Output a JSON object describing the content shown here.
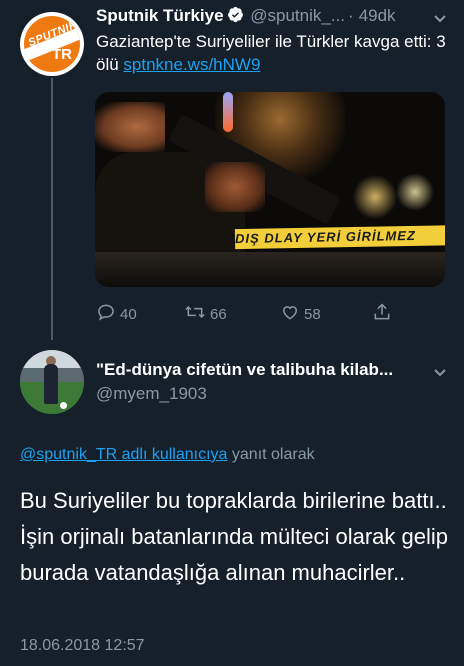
{
  "tweet1": {
    "name": "Sputnik Türkiye",
    "handle": "@sputnik_...",
    "separator": "·",
    "time": "49dk",
    "text_main": "Gaziantep'te Suriyeliler ile Türkler kavga etti: 3 ölü ",
    "link": "sptnkne.ws/hNW9",
    "avatar": {
      "brand": "SPUTNIK",
      "code": "TR",
      "color": "#f07a12"
    },
    "media": {
      "tape_text": "DIŞ   DLAY YERİ GİRİLMEZ"
    },
    "actions": {
      "replies": "40",
      "retweets": "66",
      "likes": "58"
    }
  },
  "tweet2": {
    "name": "\"Ed-dünya cifetün ve talibuha kilab...",
    "handle": "@myem_1903",
    "reply_link": "@sputnik_TR adlı kullanıcıya",
    "reply_suffix": " yanıt olarak",
    "text": "Bu Suriyeliler bu topraklarda  birilerine battı.. İşin orjinalı batanlarında mülteci olarak gelip burada vatandaşlığa alınan muhacirler..",
    "timestamp": "18.06.2018 12:57"
  },
  "colors": {
    "background": "#15202b",
    "link": "#1da1f2",
    "muted": "#8899a6",
    "text": "#ffffff"
  },
  "icons": [
    "verified-icon",
    "chevron-down-icon",
    "reply-icon",
    "retweet-icon",
    "like-icon",
    "share-icon"
  ]
}
